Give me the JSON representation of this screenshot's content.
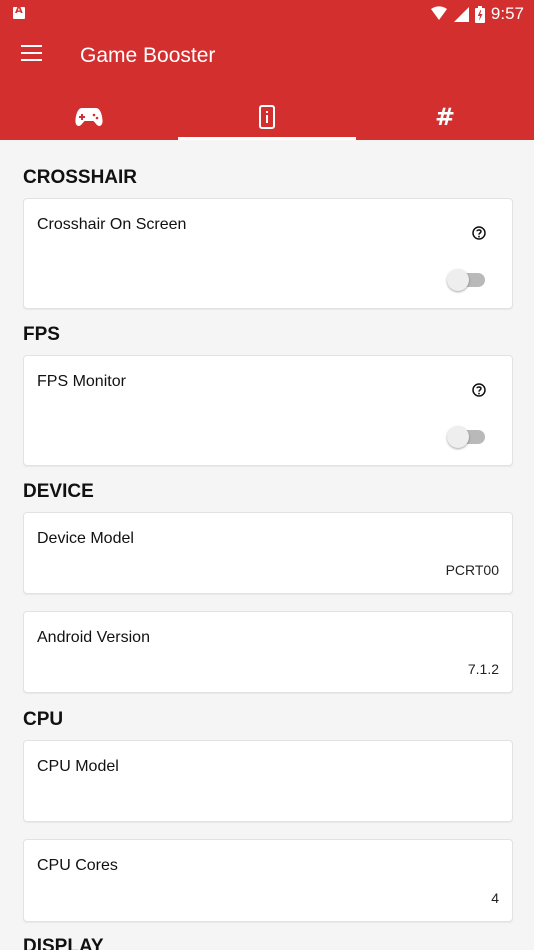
{
  "status_bar": {
    "time": "9:57",
    "icons": [
      "notification-icon",
      "wifi-icon",
      "signal-icon",
      "battery-icon"
    ]
  },
  "app_bar": {
    "title": "Game Booster",
    "menu_icon": "hamburger-menu-icon",
    "background": "#d32f2f"
  },
  "tabs": [
    {
      "icon": "gamepad-icon",
      "active": false
    },
    {
      "icon": "device-info-icon",
      "active": true
    },
    {
      "icon": "hash-icon",
      "label": "#",
      "active": false
    }
  ],
  "sections": {
    "crosshair": {
      "title": "CROSSHAIR",
      "card": {
        "title": "Crosshair On Screen",
        "toggle_on": false,
        "help_icon": "help-icon"
      }
    },
    "fps": {
      "title": "FPS",
      "card": {
        "title": "FPS Monitor",
        "toggle_on": false,
        "help_icon": "help-icon"
      }
    },
    "device": {
      "title": "DEVICE",
      "cards": [
        {
          "title": "Device Model",
          "value": "PCRT00"
        },
        {
          "title": "Android Version",
          "value": "7.1.2"
        }
      ]
    },
    "cpu": {
      "title": "CPU",
      "cards": [
        {
          "title": "CPU Model",
          "value": ""
        },
        {
          "title": "CPU Cores",
          "value": "4"
        }
      ]
    },
    "display": {
      "title": "DISPLAY"
    }
  }
}
